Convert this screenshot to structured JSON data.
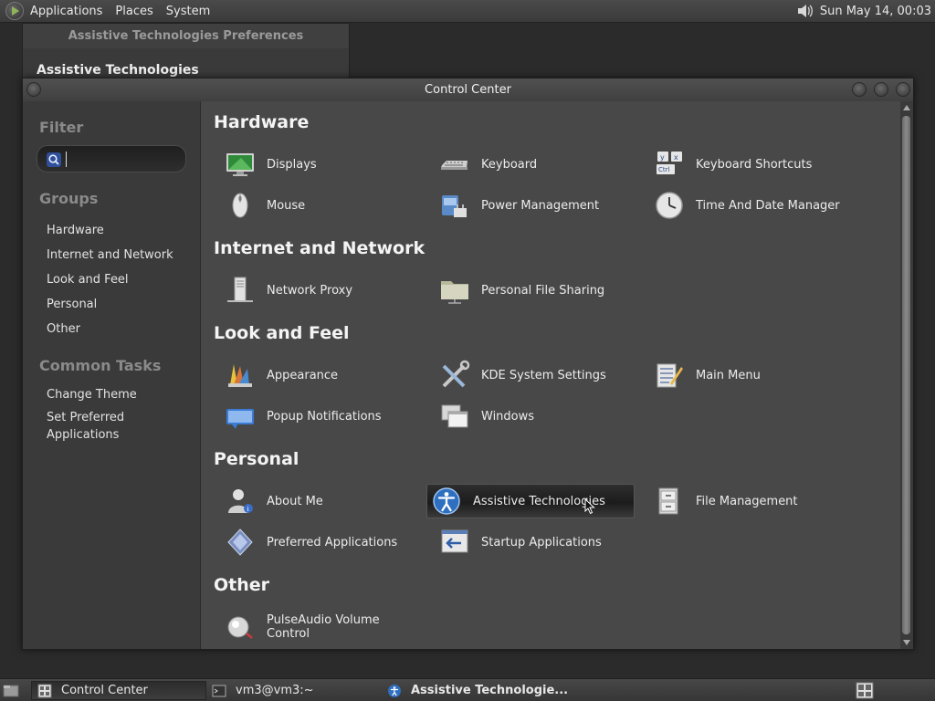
{
  "top_panel": {
    "menus": [
      "Applications",
      "Places",
      "System"
    ],
    "clock": "Sun May 14, 00:03"
  },
  "bg_window": {
    "title": "Assistive Technologies Preferences",
    "heading": "Assistive Technologies"
  },
  "window": {
    "title": "Control Center"
  },
  "sidebar": {
    "filter_heading": "Filter",
    "search_value": "",
    "groups_heading": "Groups",
    "groups": [
      "Hardware",
      "Internet and Network",
      "Look and Feel",
      "Personal",
      "Other"
    ],
    "tasks_heading": "Common Tasks",
    "tasks": [
      "Change Theme",
      "Set Preferred Applications"
    ]
  },
  "categories": [
    {
      "name": "Hardware",
      "items": [
        {
          "label": "Displays",
          "icon": "monitor-icon"
        },
        {
          "label": "Keyboard",
          "icon": "keyboard-icon"
        },
        {
          "label": "Keyboard Shortcuts",
          "icon": "keyboard-shortcuts-icon"
        },
        {
          "label": "Mouse",
          "icon": "mouse-icon"
        },
        {
          "label": "Power Management",
          "icon": "power-icon"
        },
        {
          "label": "Time And Date Manager",
          "icon": "clock-icon"
        }
      ]
    },
    {
      "name": "Internet and Network",
      "items": [
        {
          "label": "Network Proxy",
          "icon": "network-proxy-icon"
        },
        {
          "label": "Personal File Sharing",
          "icon": "folder-share-icon"
        }
      ]
    },
    {
      "name": "Look and Feel",
      "items": [
        {
          "label": "Appearance",
          "icon": "appearance-icon"
        },
        {
          "label": "KDE System Settings",
          "icon": "tools-icon"
        },
        {
          "label": "Main Menu",
          "icon": "menu-editor-icon"
        },
        {
          "label": "Popup Notifications",
          "icon": "notification-icon"
        },
        {
          "label": "Windows",
          "icon": "windows-icon"
        }
      ]
    },
    {
      "name": "Personal",
      "items": [
        {
          "label": "About Me",
          "icon": "user-icon"
        },
        {
          "label": "Assistive Technologies",
          "icon": "accessibility-icon"
        },
        {
          "label": "File Management",
          "icon": "file-cabinet-icon"
        },
        {
          "label": "Preferred Applications",
          "icon": "preferred-apps-icon"
        },
        {
          "label": "Startup Applications",
          "icon": "startup-icon"
        }
      ]
    },
    {
      "name": "Other",
      "items": [
        {
          "label": "PulseAudio Volume Control",
          "icon": "volume-icon"
        }
      ]
    }
  ],
  "taskbar": {
    "tasks": [
      "Control Center",
      "vm3@vm3:~",
      "Assistive Technologie..."
    ]
  }
}
